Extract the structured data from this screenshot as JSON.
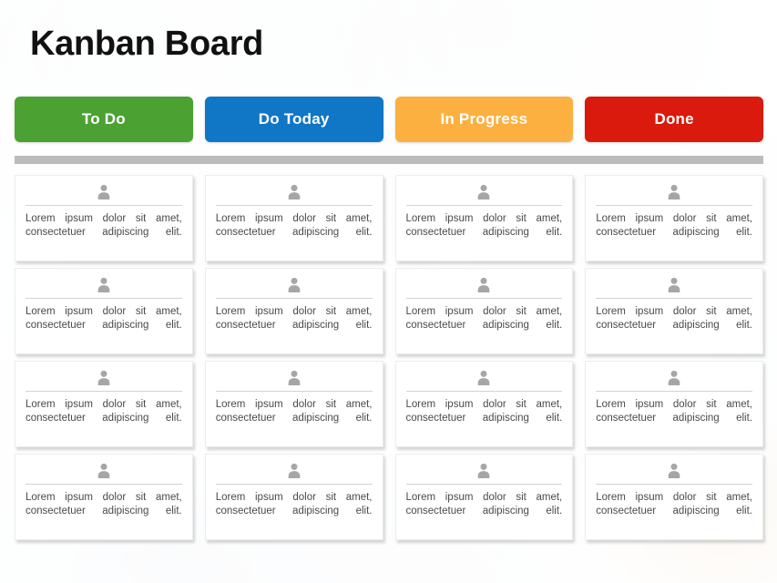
{
  "board": {
    "title": "Kanban Board",
    "columns": [
      {
        "label": "To Do",
        "color": "#4BA232"
      },
      {
        "label": "Do Today",
        "color": "#1076C6"
      },
      {
        "label": "In Progress",
        "color": "#FBB040"
      },
      {
        "label": "Done",
        "color": "#D91A0C"
      }
    ],
    "separator_color": "#BCBCBC",
    "card_text": "Lorem ipsum dolor sit amet, consectetuer adipiscing elit.",
    "avatar_icon": "person-icon",
    "rows": [
      {
        "cards": [
          {
            "text": "Lorem ipsum dolor sit amet, consectetuer adipiscing elit."
          },
          {
            "text": "Lorem ipsum dolor sit amet, consectetuer adipiscing elit."
          },
          {
            "text": "Lorem ipsum dolor sit amet, consectetuer adipiscing elit."
          },
          {
            "text": "Lorem ipsum dolor sit amet, consectetuer adipiscing elit."
          }
        ]
      },
      {
        "cards": [
          {
            "text": "Lorem ipsum dolor sit amet, consectetuer adipiscing elit."
          },
          {
            "text": "Lorem ipsum dolor sit amet, consectetuer adipiscing elit."
          },
          {
            "text": "Lorem ipsum dolor sit amet, consectetuer adipiscing elit."
          },
          {
            "text": "Lorem ipsum dolor sit amet, consectetuer adipiscing elit."
          }
        ]
      },
      {
        "cards": [
          {
            "text": "Lorem ipsum dolor sit amet, consectetuer adipiscing elit."
          },
          {
            "text": "Lorem ipsum dolor sit amet, consectetuer adipiscing elit."
          },
          {
            "text": "Lorem ipsum dolor sit amet, consectetuer adipiscing elit."
          },
          {
            "text": "Lorem ipsum dolor sit amet, consectetuer adipiscing elit."
          }
        ]
      },
      {
        "cards": [
          {
            "text": "Lorem ipsum dolor sit amet, consectetuer adipiscing elit."
          },
          {
            "text": "Lorem ipsum dolor sit amet, consectetuer adipiscing elit."
          },
          {
            "text": "Lorem ipsum dolor sit amet, consectetuer adipiscing elit."
          },
          {
            "text": "Lorem ipsum dolor sit amet, consectetuer adipiscing elit."
          }
        ]
      }
    ]
  }
}
